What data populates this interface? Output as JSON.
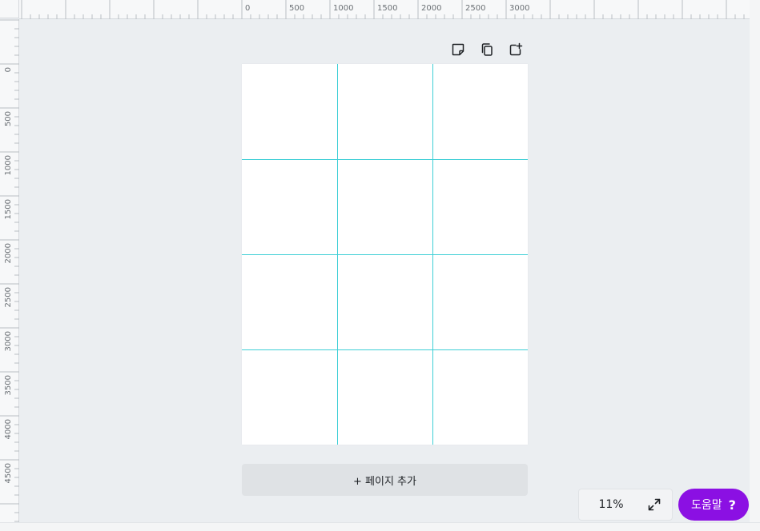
{
  "ruler": {
    "top_labels": [
      "0",
      "500",
      "1000",
      "1500",
      "2000",
      "2500",
      "3000"
    ],
    "left_labels": [
      "0",
      "500",
      "1000",
      "1500",
      "2000",
      "2500",
      "3000",
      "3500",
      "4000",
      "4500"
    ]
  },
  "page": {
    "grid_columns": 3,
    "grid_rows": 4,
    "guide_color": "#3ecfd6",
    "background": "#ffffff"
  },
  "toolbar": {
    "icons": [
      "sticky-note-icon",
      "duplicate-page-icon",
      "add-page-icon"
    ]
  },
  "add_page": {
    "label": "+ 페이지 추가"
  },
  "zoom": {
    "value": "11%"
  },
  "help": {
    "label": "도움말",
    "icon_glyph": "?"
  },
  "colors": {
    "accent": "#8b10e3",
    "canvas_bg": "#ebeef1",
    "ruler_bg": "#f7f8f9"
  }
}
